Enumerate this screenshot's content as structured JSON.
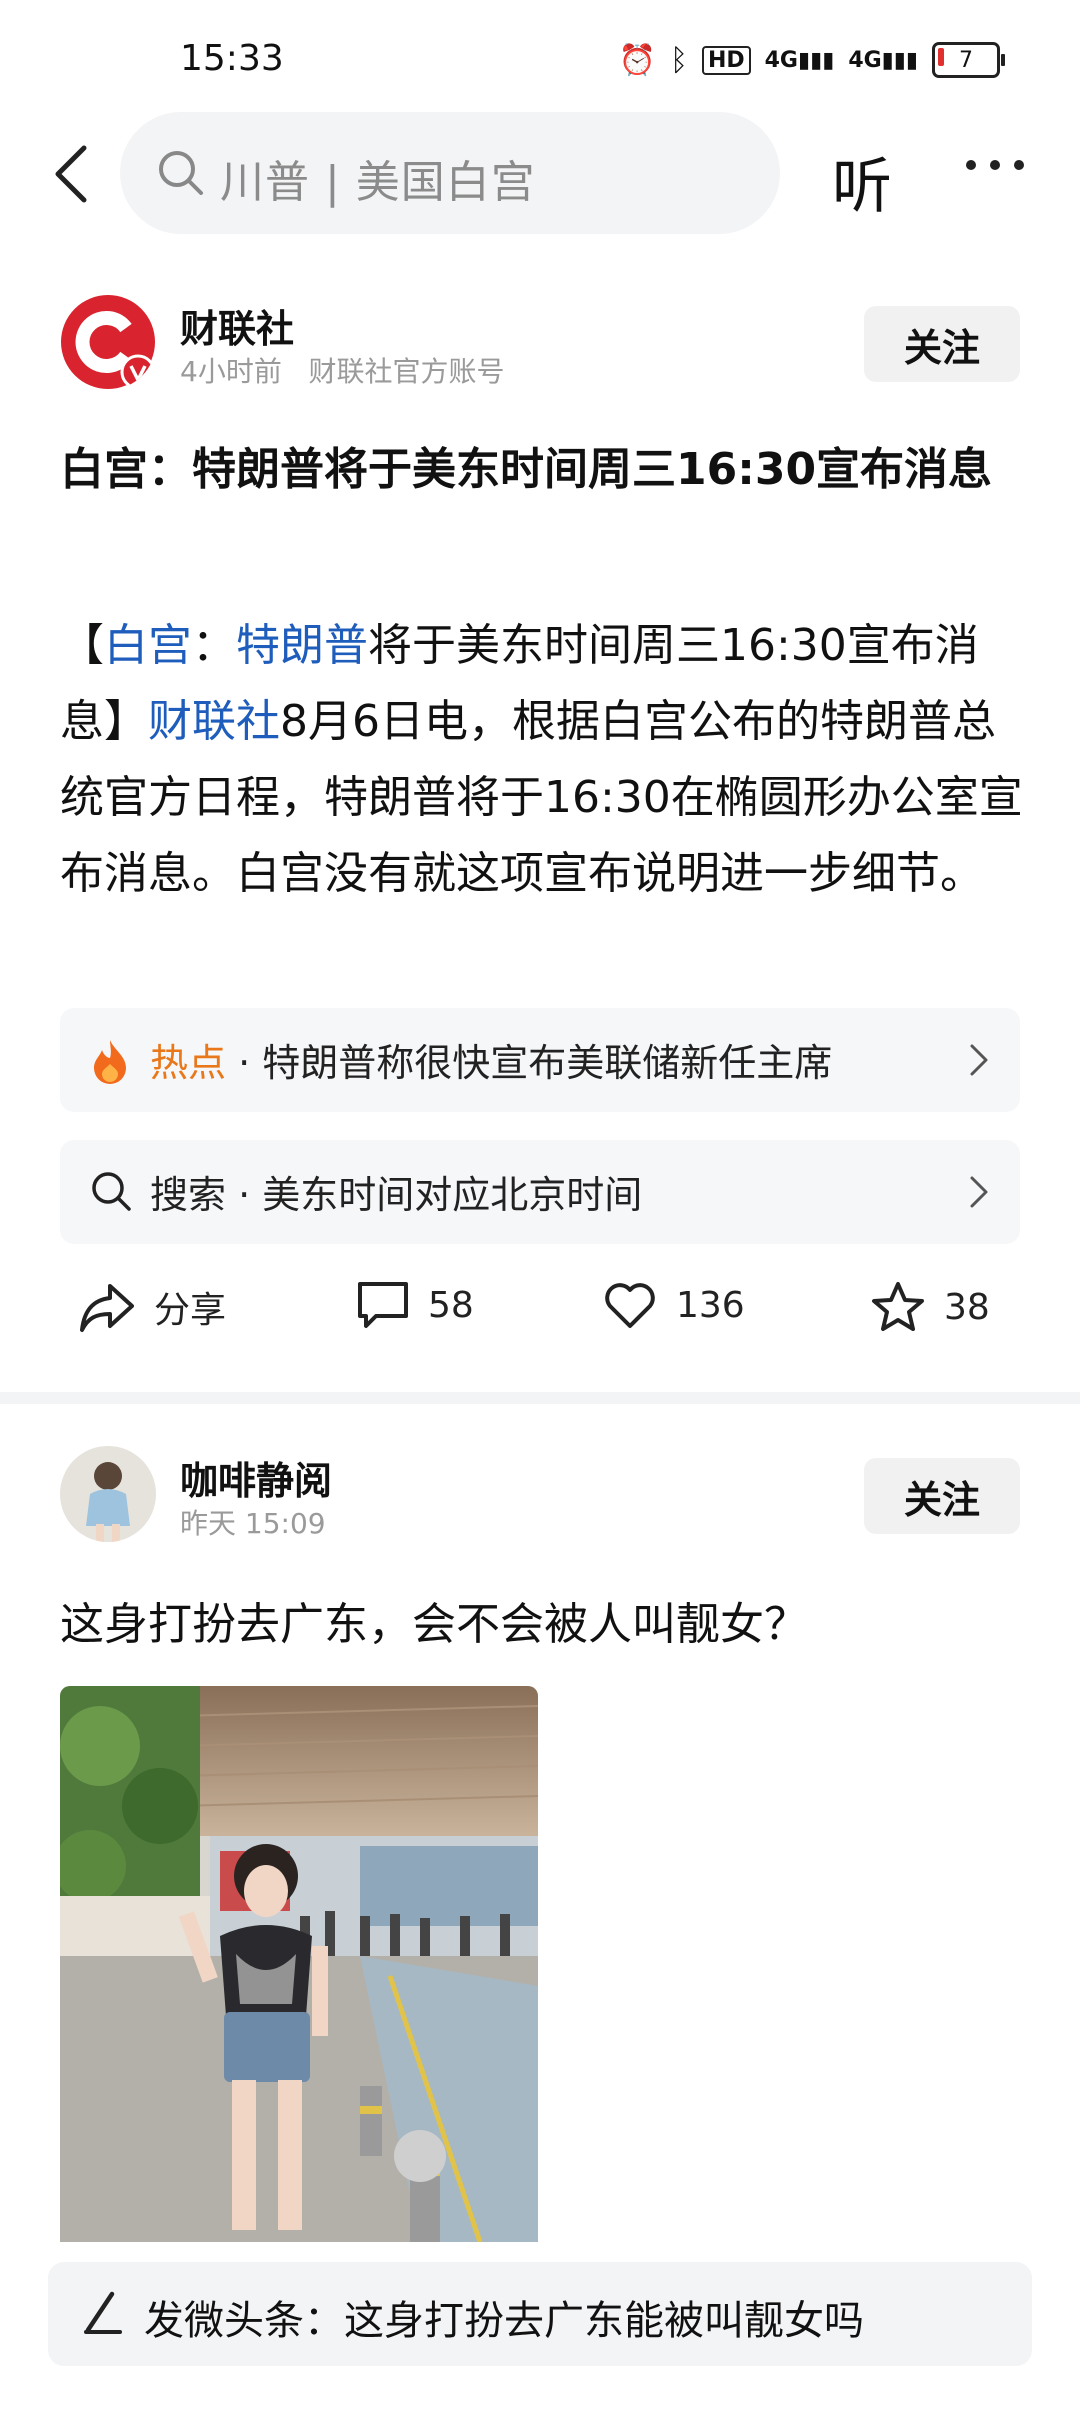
{
  "status_bar": {
    "time": "15:33",
    "battery": "7"
  },
  "nav": {
    "search_placeholder": "川普 | 美国白宫",
    "listen_label": "听"
  },
  "post1": {
    "author": "财联社",
    "time": "4小时前",
    "account_type": "财联社官方账号",
    "follow_label": "关注",
    "title": "白宫：特朗普将于美东时间周三16:30宣布消息",
    "body": {
      "bracket_open": "【",
      "link1": "白宫",
      "sep": "：",
      "link2": "特朗普",
      "headline_rest": "将于美东时间周三16:30宣布消息】",
      "link3": "财联社",
      "paragraph": "8月6日电，根据白宫公布的特朗普总统官方日程，特朗普将于16:30在椭圆形办公室宣布消息。白宫没有就这项宣布说明进一步细节。"
    },
    "hot": {
      "tag": "热点",
      "text": "· 特朗普称很快宣布美联储新任主席"
    },
    "search": {
      "tag": "搜索",
      "text": "· 美东时间对应北京时间"
    },
    "actions": {
      "share_label": "分享",
      "comments": "58",
      "likes": "136",
      "stars": "38"
    }
  },
  "post2": {
    "author": "咖啡静阅",
    "time": "昨天  15:09",
    "follow_label": "关注",
    "title": "这身打扮去广东，会不会被人叫靓女？"
  },
  "compose": {
    "text": "发微头条：这身打扮去广东能被叫靓女吗"
  },
  "colors": {
    "link": "#1e5dbb",
    "hot_orange": "#e8781a",
    "brand_red": "#d9232e"
  }
}
